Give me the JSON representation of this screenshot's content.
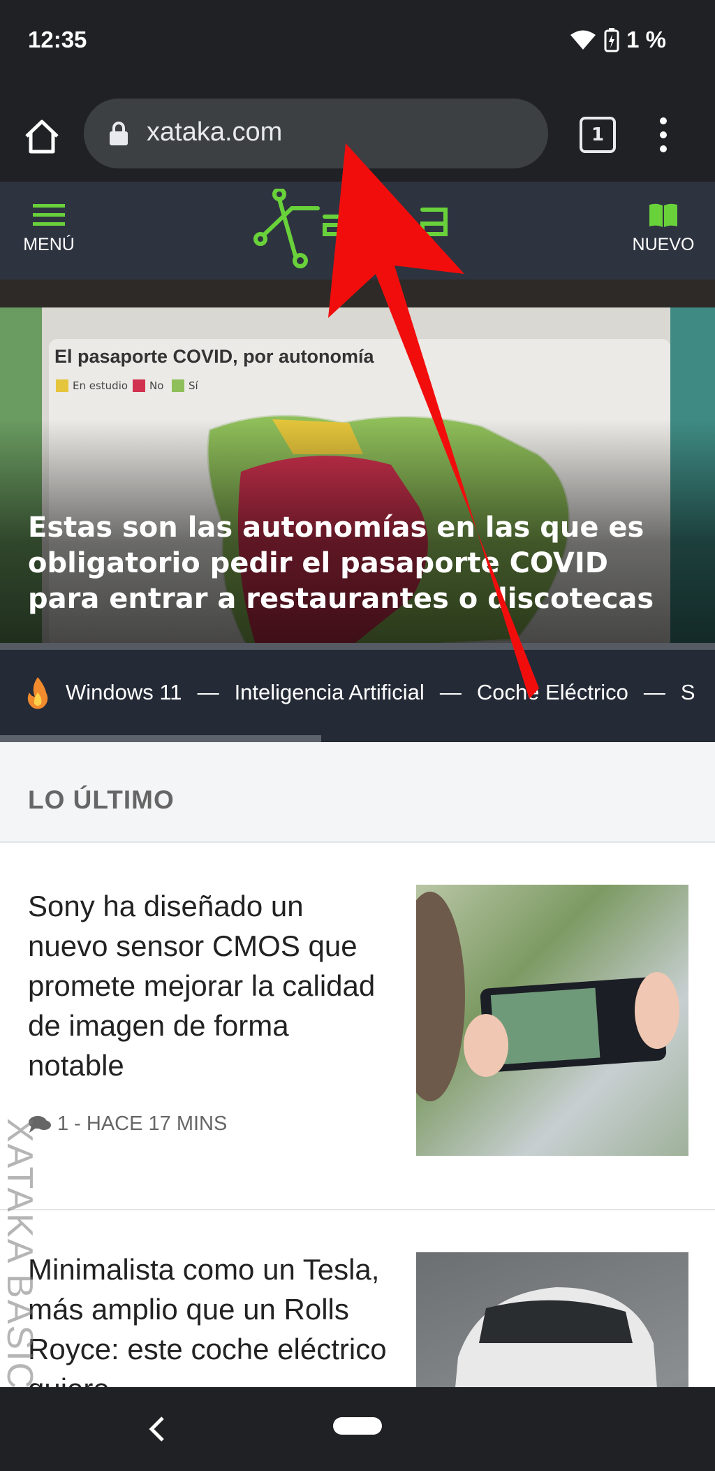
{
  "status_bar": {
    "time": "12:35",
    "battery": "1 %"
  },
  "browser": {
    "url": "xataka.com",
    "tab_count": "1"
  },
  "site_header": {
    "menu_label": "MENÚ",
    "new_label": "NUEVO"
  },
  "hero": {
    "image_title": "El pasaporte COVID, por autonomía",
    "legend": [
      "En estudio",
      "No",
      "Sí"
    ],
    "headline": "Estas son las autonomías en las que es obligatorio pedir el pasaporte COVID para entrar a restaurantes o discotecas"
  },
  "trending": {
    "items": [
      "Windows 11",
      "Inteligencia Artificial",
      "Coche Eléctrico",
      "S"
    ]
  },
  "latest": {
    "section_title": "LO ÚLTIMO",
    "articles": [
      {
        "title": "Sony ha diseñado un nuevo sensor CMOS que promete mejorar la calidad de imagen de forma notable",
        "meta": "1 - HACE 17 MINS"
      },
      {
        "title": "Minimalista como un Tesla, más amplio que un Rolls Royce: este coche eléctrico quiere"
      }
    ]
  },
  "watermark": "XATAKA BASICS",
  "colors": {
    "accent": "#69d23b",
    "arrow": "#f20d0d",
    "header_bg": "#2e3340"
  }
}
